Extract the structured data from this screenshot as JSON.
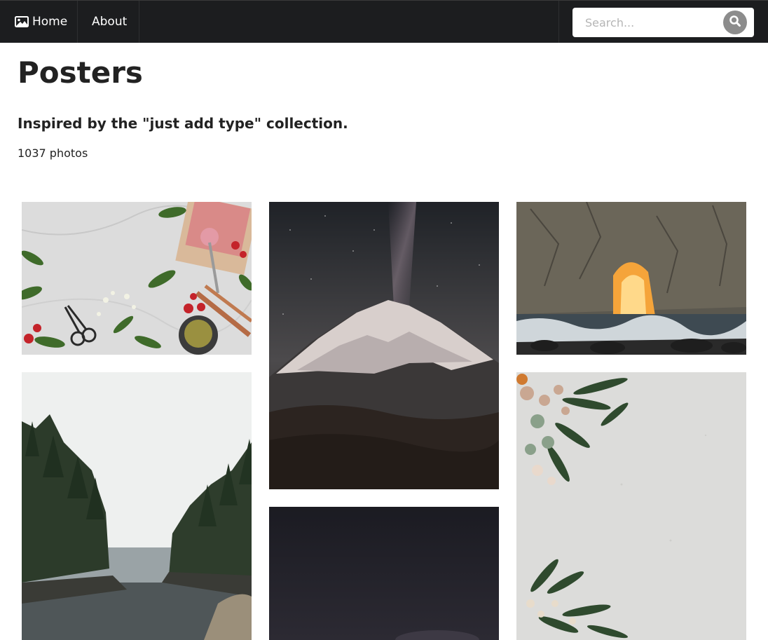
{
  "navbar": {
    "home_label": "Home",
    "home_icon": "image-icon",
    "about_label": "About"
  },
  "search": {
    "placeholder": "Search...",
    "value": "",
    "button_icon": "search-icon"
  },
  "collection": {
    "title": "Posters",
    "description": "Inspired by the \"just add type\" collection.",
    "count_text": "1037 photos"
  },
  "photos": [
    {
      "subject": "flat lay of strawberry ice cream, herbs, scissors on marble"
    },
    {
      "subject": "snowy mountain under milky way at night"
    },
    {
      "subject": "sea arch with sunlight and waves"
    },
    {
      "subject": "misty river between pine forests"
    },
    {
      "subject": "dark night sky"
    },
    {
      "subject": "dried flowers on light grey background"
    }
  ],
  "colors": {
    "navbar_bg": "#1c1d1f",
    "search_button": "#8c8c8c",
    "text": "#222222"
  }
}
